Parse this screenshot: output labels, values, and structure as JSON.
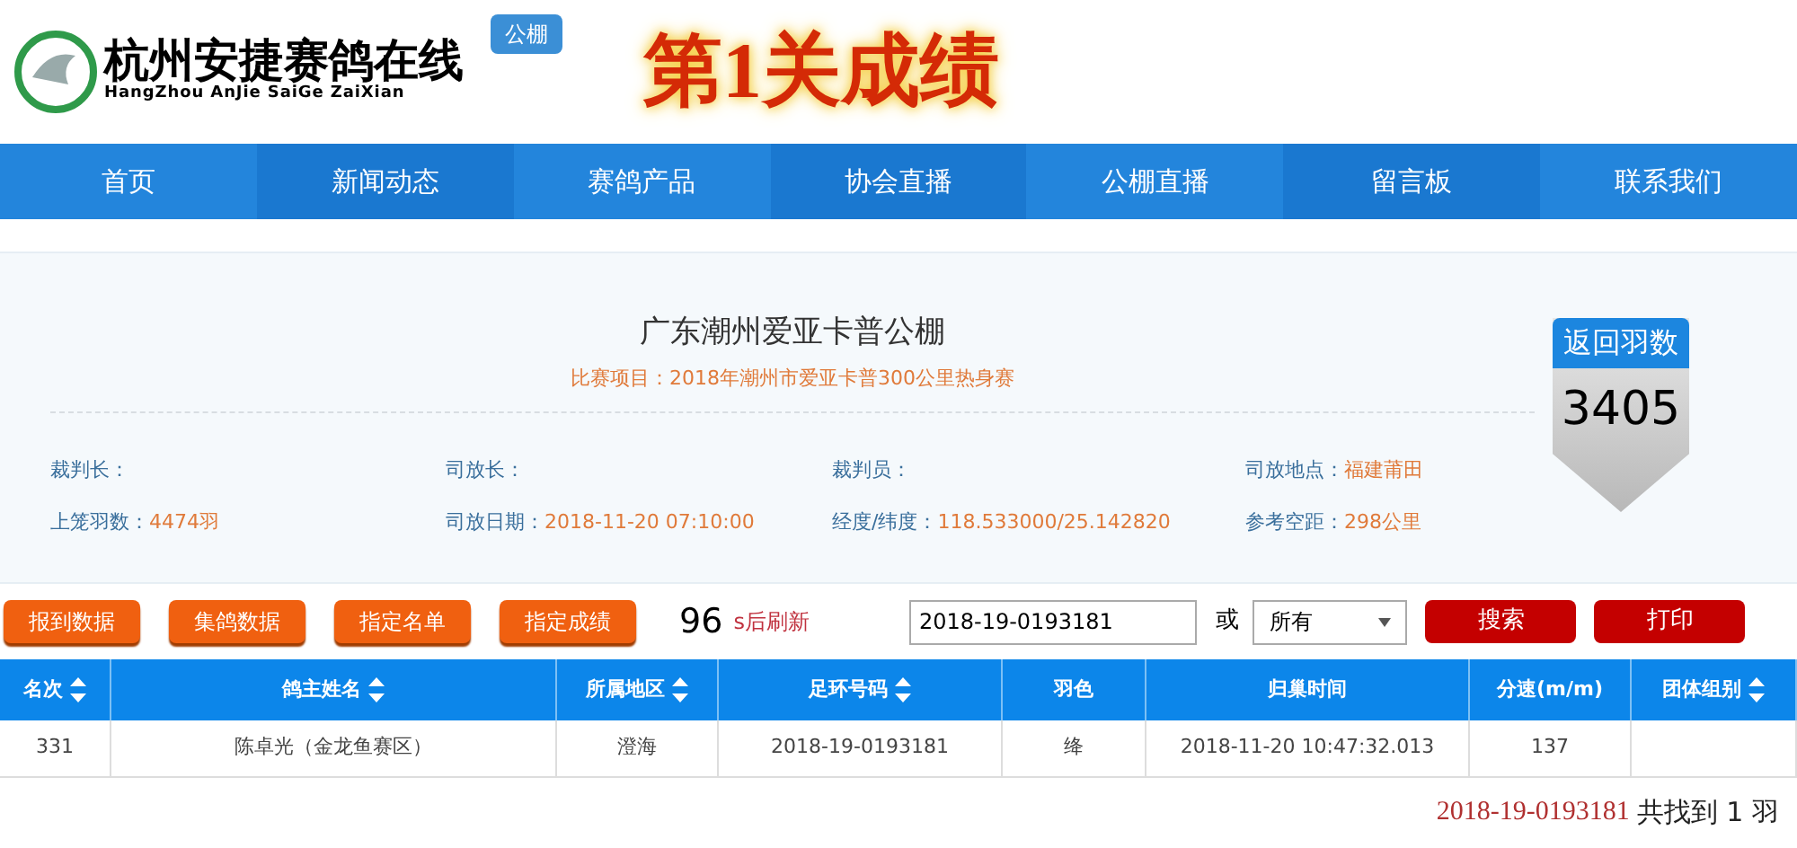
{
  "logo": {
    "name": "杭州安捷赛鸽在线",
    "pinyin": "HangZhou AnJie SaiGe ZaiXian",
    "badge": "公棚"
  },
  "page_title": "第1关成绩",
  "nav": [
    {
      "label": "首页"
    },
    {
      "label": "新闻动态"
    },
    {
      "label": "赛鸽产品"
    },
    {
      "label": "协会直播"
    },
    {
      "label": "公棚直播"
    },
    {
      "label": "留言板"
    },
    {
      "label": "联系我们"
    }
  ],
  "race": {
    "loft": "广东潮州爱亚卡普公棚",
    "event_label": "比赛项目：",
    "event": "2018年潮州市爱亚卡普300公里热身赛",
    "fields": [
      {
        "label": "裁判长："
      },
      {
        "label": "司放长："
      },
      {
        "label": "裁判员："
      },
      {
        "label": "司放地点：",
        "value": "福建莆田"
      },
      {
        "label": "上笼羽数：",
        "value": "4474羽"
      },
      {
        "label": "司放日期：",
        "value": "2018-11-20 07:10:00"
      },
      {
        "label": "经度/纬度：",
        "value": "118.533000/25.142820"
      },
      {
        "label": "参考空距：",
        "value": "298公里"
      }
    ],
    "returned_label": "返回羽数",
    "returned_count": "3405"
  },
  "toolbar": {
    "buttons": [
      "报到数据",
      "集鸽数据",
      "指定名单",
      "指定成绩"
    ],
    "countdown": "96",
    "countdown_suffix": "s后刷新",
    "search_value": "2018-19-0193181",
    "or": "或",
    "filter": "所有",
    "actions": [
      "搜索",
      "打印"
    ]
  },
  "table": {
    "columns": [
      {
        "label": "名次",
        "sortable": true
      },
      {
        "label": "鸽主姓名",
        "sortable": true
      },
      {
        "label": "所属地区",
        "sortable": true
      },
      {
        "label": "足环号码",
        "sortable": true
      },
      {
        "label": "羽色",
        "sortable": false
      },
      {
        "label": "归巢时间",
        "sortable": false
      },
      {
        "label": "分速(m/m)",
        "sortable": false
      },
      {
        "label": "团体组别",
        "sortable": true
      }
    ],
    "rows": [
      [
        "331",
        "陈卓光（金龙鱼赛区）",
        "澄海",
        "2018-19-0193181",
        "绛",
        "2018-11-20 10:47:32.013",
        "137",
        null
      ]
    ]
  },
  "result": {
    "ring": "2018-19-0193181",
    "summary": "共找到 1 羽"
  }
}
